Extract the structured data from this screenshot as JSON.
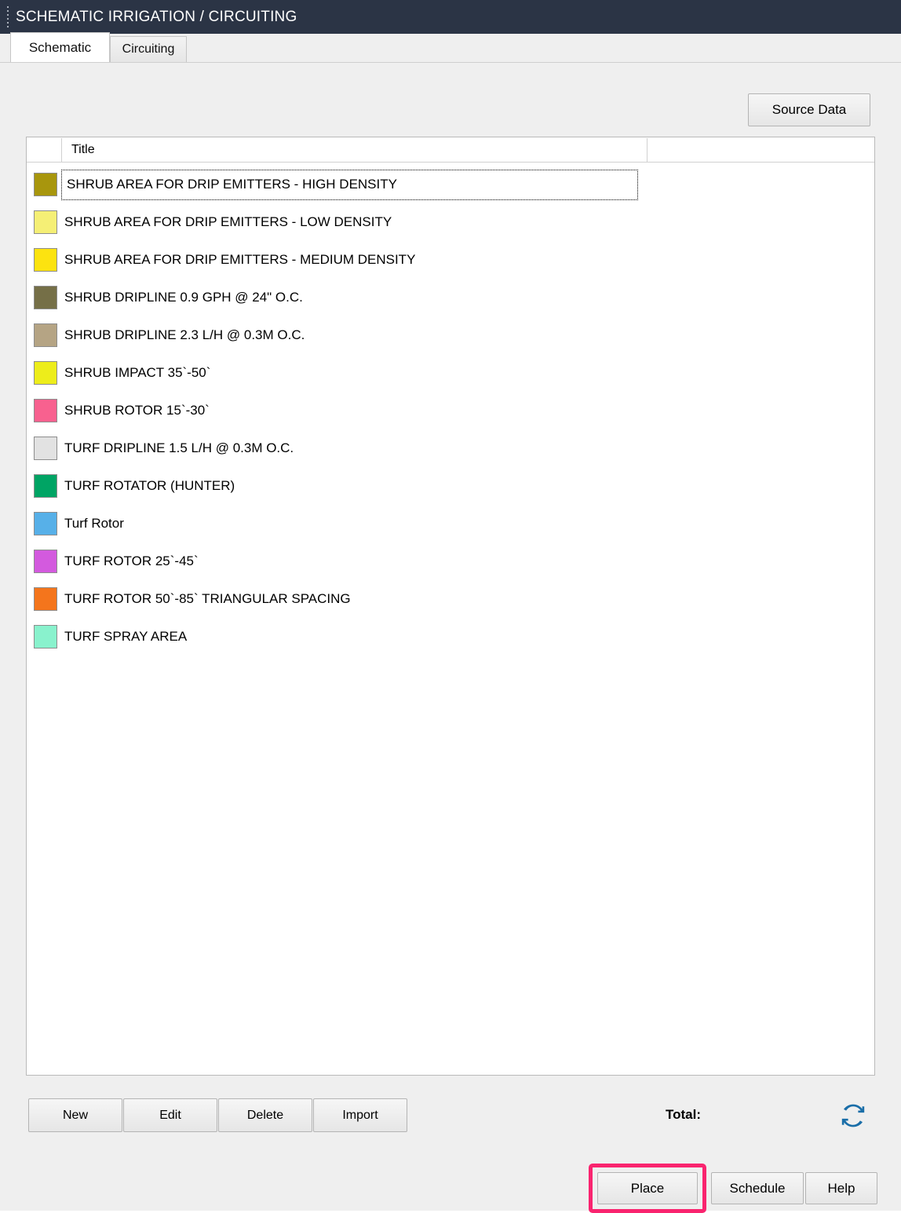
{
  "window": {
    "title": "SCHEMATIC IRRIGATION / CIRCUITING",
    "grip_icon": "drag-grip-icon"
  },
  "tabs": [
    {
      "label": "Schematic",
      "active": true
    },
    {
      "label": "Circuiting",
      "active": false
    }
  ],
  "toolbar": {
    "source_data_label": "Source Data"
  },
  "list": {
    "columns": [
      "",
      "Title"
    ],
    "items": [
      {
        "color": "#a8960d",
        "title": "SHRUB AREA FOR DRIP EMITTERS - HIGH DENSITY",
        "selected": true
      },
      {
        "color": "#f5ef75",
        "title": "SHRUB AREA FOR DRIP EMITTERS - LOW DENSITY",
        "selected": false
      },
      {
        "color": "#fce310",
        "title": "SHRUB AREA FOR DRIP EMITTERS - MEDIUM DENSITY",
        "selected": false
      },
      {
        "color": "#756f47",
        "title": "SHRUB DRIPLINE 0.9 GPH @ 24\" O.C.",
        "selected": false
      },
      {
        "color": "#b5a484",
        "title": "SHRUB DRIPLINE 2.3 L/H @ 0.3M O.C.",
        "selected": false
      },
      {
        "color": "#eded1b",
        "title": "SHRUB IMPACT 35`-50`",
        "selected": false
      },
      {
        "color": "#f8618f",
        "title": "SHRUB ROTOR 15`-30`",
        "selected": false
      },
      {
        "color": "#e2e2e2",
        "title": "TURF DRIPLINE 1.5 L/H @ 0.3M O.C.",
        "selected": false
      },
      {
        "color": "#00a464",
        "title": "TURF ROTATOR (HUNTER)",
        "selected": false
      },
      {
        "color": "#57b0e8",
        "title": "Turf Rotor",
        "selected": false
      },
      {
        "color": "#d35ade",
        "title": "TURF ROTOR 25`-45`",
        "selected": false
      },
      {
        "color": "#f4751c",
        "title": "TURF ROTOR 50`-85` TRIANGULAR SPACING",
        "selected": false
      },
      {
        "color": "#89f2cd",
        "title": "TURF SPRAY AREA",
        "selected": false
      }
    ]
  },
  "footer": {
    "new_label": "New",
    "edit_label": "Edit",
    "delete_label": "Delete",
    "import_label": "Import",
    "total_label": "Total:",
    "total_value": "",
    "refresh_icon": "refresh-icon",
    "refresh_color": "#1a6ea8"
  },
  "actions": {
    "place_label": "Place",
    "schedule_label": "Schedule",
    "help_label": "Help",
    "highlight_color": "#f9246f"
  }
}
